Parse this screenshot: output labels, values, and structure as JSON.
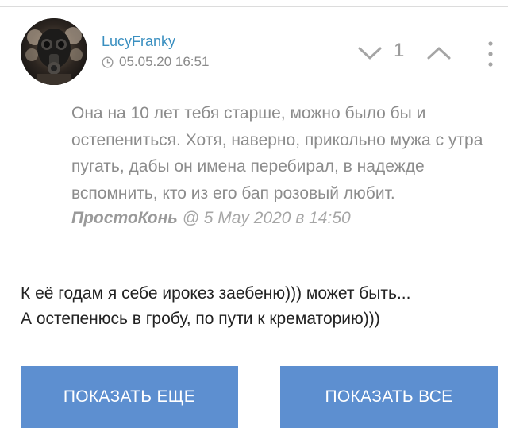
{
  "comment": {
    "author": "LucyFranky",
    "timestamp": "05.05.20 16:51",
    "icons": {
      "avatar": "avatar-gas-mask",
      "time": "clock-icon",
      "downvote": "chevron-down-icon",
      "upvote": "chevron-up-icon",
      "menu": "more-vertical-icon"
    },
    "rating": "1",
    "quote": {
      "text": "Она на 10 лет тебя старше, можно было бы и остепениться. Хотя, наверно, прикольно мужа с утра пугать, дабы он имена перебирал, в надежде вспомнить, кто из его бап розовый любит.",
      "author": "ПростоКонь",
      "meta": " @ 5 May 2020 в 14:50"
    },
    "body_lines": [
      "К её годам я себе ирокез заебеню))) может быть...",
      "А остепенюсь в гробу, по пути к крематорию)))"
    ]
  },
  "actions": {
    "show_more_label": "ПОКАЗАТЬ ЕЩЕ",
    "show_all_label": "ПОКАЗАТЬ ВСЕ"
  },
  "colors": {
    "username": "#3a8fc0",
    "button": "#5d8fd0"
  }
}
